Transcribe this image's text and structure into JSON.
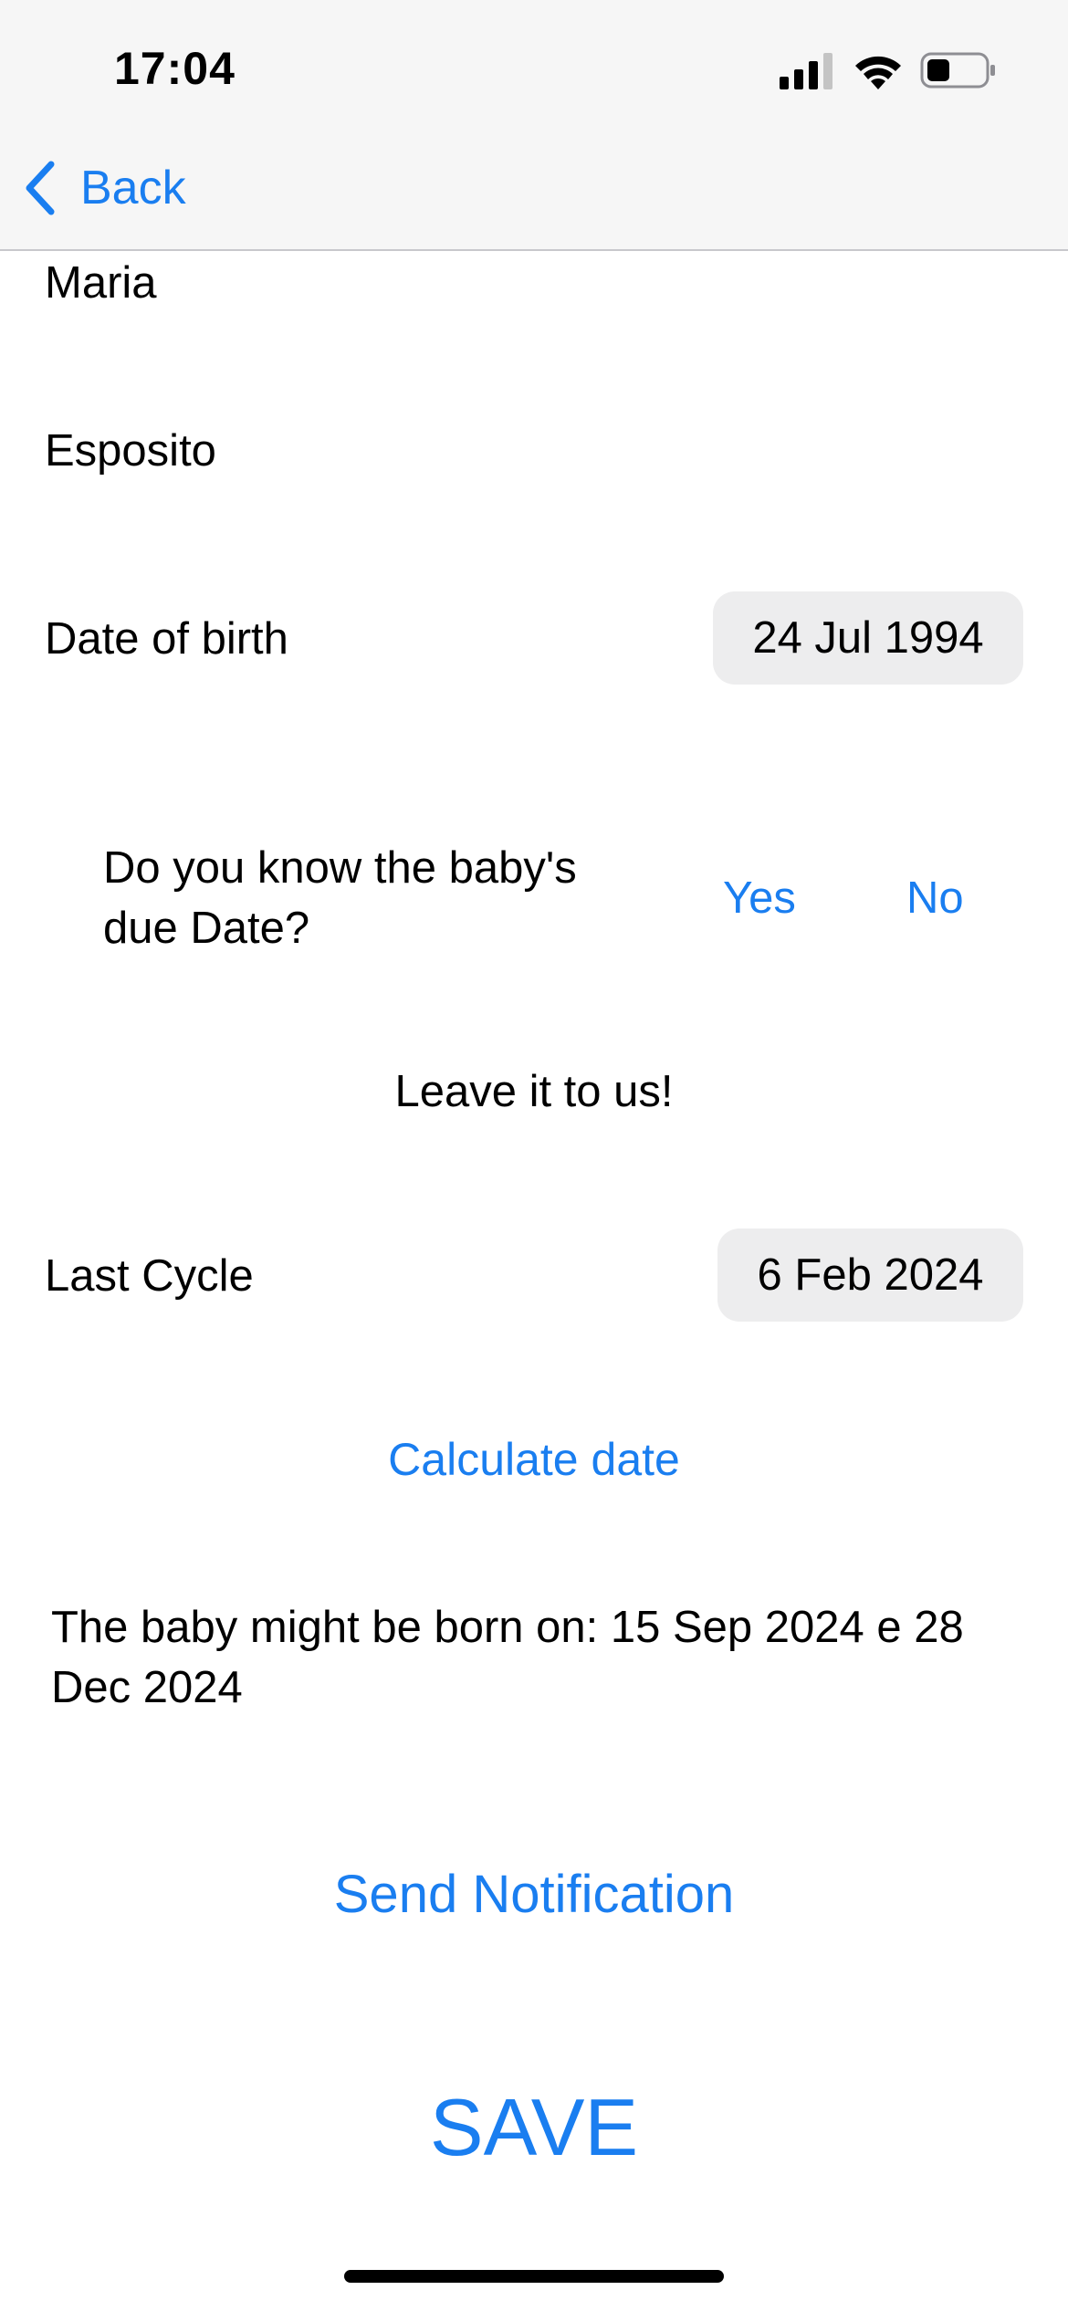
{
  "status_bar": {
    "time": "17:04",
    "icons": [
      "cellular-signal-icon",
      "wifi-icon",
      "battery-icon"
    ]
  },
  "nav": {
    "back_label": "Back",
    "icon": "chevron-left-icon"
  },
  "form": {
    "first_name": "Maria",
    "last_name": "Esposito",
    "dob_label": "Date of birth",
    "dob_value": "24 Jul 1994",
    "due_question": "Do you know the baby's due Date?",
    "yes_label": "Yes",
    "no_label": "No",
    "leave_it_text": "Leave it to us!",
    "last_cycle_label": "Last Cycle",
    "last_cycle_value": "6 Feb 2024",
    "calculate_label": "Calculate date",
    "result_text": "The baby might be born on: 15 Sep 2024 e 28 Dec 2024",
    "send_notification_label": "Send Notification",
    "save_label": "SAVE"
  },
  "colors": {
    "accent": "#1a7ef0",
    "topbar_bg": "#f6f6f6",
    "pill_bg": "#ededee",
    "text": "#000000"
  }
}
